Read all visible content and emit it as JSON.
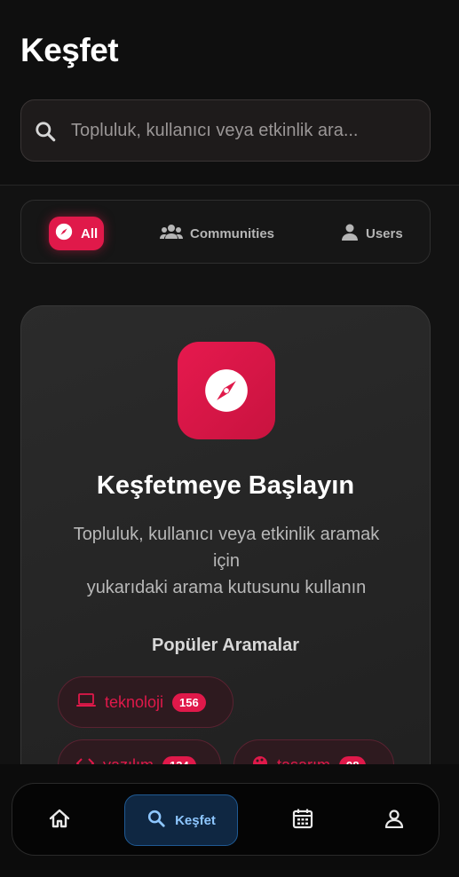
{
  "header": {
    "title": "Keşfet"
  },
  "search": {
    "placeholder": "Topluluk, kullanıcı veya etkinlik ara..."
  },
  "filters": [
    {
      "label": "All",
      "icon": "compass-icon",
      "active": true
    },
    {
      "label": "Communities",
      "icon": "users-group-icon",
      "active": false
    },
    {
      "label": "Users",
      "icon": "user-icon",
      "active": false
    }
  ],
  "empty_state": {
    "title": "Keşfetmeye Başlayın",
    "desc_line1": "Topluluk, kullanıcı veya etkinlik aramak",
    "desc_line2": "için",
    "desc_line3": "yukarıdaki arama kutusunu kullanın",
    "popular_title": "Popüler Aramalar",
    "popular": [
      {
        "label": "teknoloji",
        "count": "156",
        "icon": "laptop-icon"
      },
      {
        "label": "yazılım",
        "count": "134",
        "icon": "code-icon"
      },
      {
        "label": "tasarım",
        "count": "98",
        "icon": "palette-icon"
      }
    ]
  },
  "bottom_nav": [
    {
      "label": "",
      "icon": "home-icon",
      "active": false
    },
    {
      "label": "Keşfet",
      "icon": "search-icon",
      "active": true
    },
    {
      "label": "",
      "icon": "calendar-icon",
      "active": false
    },
    {
      "label": "",
      "icon": "profile-icon",
      "active": false
    }
  ],
  "colors": {
    "accent": "#e0194a",
    "nav_active": "#8ec7ff",
    "background": "#121212"
  }
}
